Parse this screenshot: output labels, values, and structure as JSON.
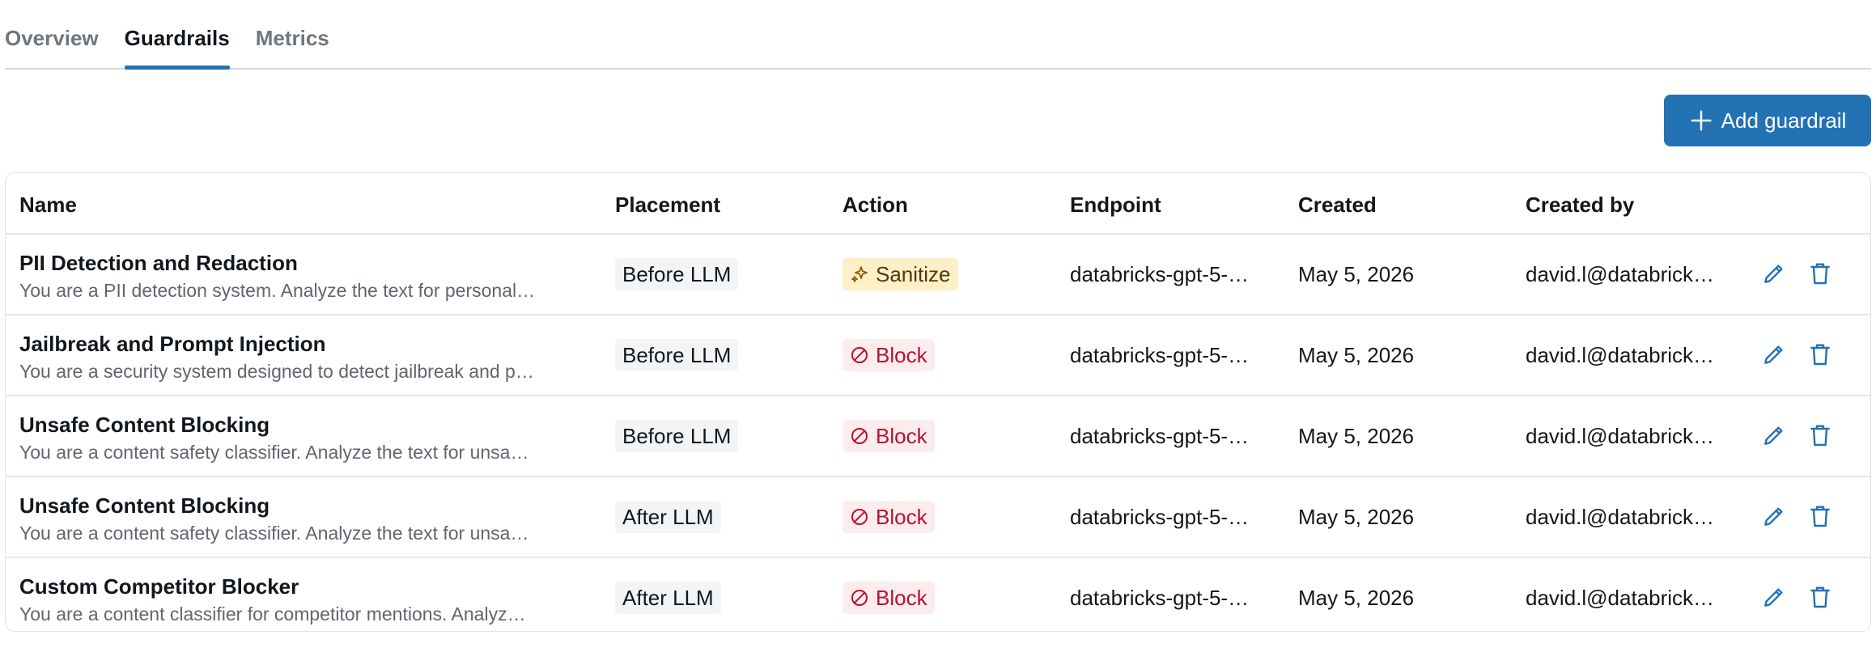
{
  "tabs": [
    {
      "label": "Overview",
      "active": false
    },
    {
      "label": "Guardrails",
      "active": true
    },
    {
      "label": "Metrics",
      "active": false
    }
  ],
  "add_button": {
    "label": "Add guardrail",
    "icon": "plus-icon"
  },
  "table": {
    "columns": {
      "name": "Name",
      "placement": "Placement",
      "action": "Action",
      "endpoint": "Endpoint",
      "created": "Created",
      "created_by": "Created by"
    },
    "rows": [
      {
        "name": "PII Detection and Redaction",
        "description": "You are a PII detection system. Analyze the text for personal…",
        "placement": "Before LLM",
        "action": "Sanitize",
        "action_icon": "sparkle-icon",
        "endpoint": "databricks-gpt-5-…",
        "created": "May 5, 2026",
        "created_by": "david.l@databrick…"
      },
      {
        "name": "Jailbreak and Prompt Injection",
        "description": "You are a security system designed to detect jailbreak and p…",
        "placement": "Before LLM",
        "action": "Block",
        "action_icon": "block-icon",
        "endpoint": "databricks-gpt-5-…",
        "created": "May 5, 2026",
        "created_by": "david.l@databrick…"
      },
      {
        "name": "Unsafe Content Blocking",
        "description": "You are a content safety classifier. Analyze the text for unsa…",
        "placement": "Before LLM",
        "action": "Block",
        "action_icon": "block-icon",
        "endpoint": "databricks-gpt-5-…",
        "created": "May 5, 2026",
        "created_by": "david.l@databrick…"
      },
      {
        "name": "Unsafe Content Blocking",
        "description": "You are a content safety classifier. Analyze the text for unsa…",
        "placement": "After LLM",
        "action": "Block",
        "action_icon": "block-icon",
        "endpoint": "databricks-gpt-5-…",
        "created": "May 5, 2026",
        "created_by": "david.l@databrick…"
      },
      {
        "name": "Custom Competitor Blocker",
        "description": "You are a content classifier for competitor mentions. Analyz…",
        "placement": "After LLM",
        "action": "Block",
        "action_icon": "block-icon",
        "endpoint": "databricks-gpt-5-…",
        "created": "May 5, 2026",
        "created_by": "david.l@databrick…"
      }
    ]
  },
  "colors": {
    "accent": "#2272b4",
    "sanitize_bg": "#fdf0c9",
    "block_bg": "#fdecee",
    "block_text": "#b7122f"
  }
}
